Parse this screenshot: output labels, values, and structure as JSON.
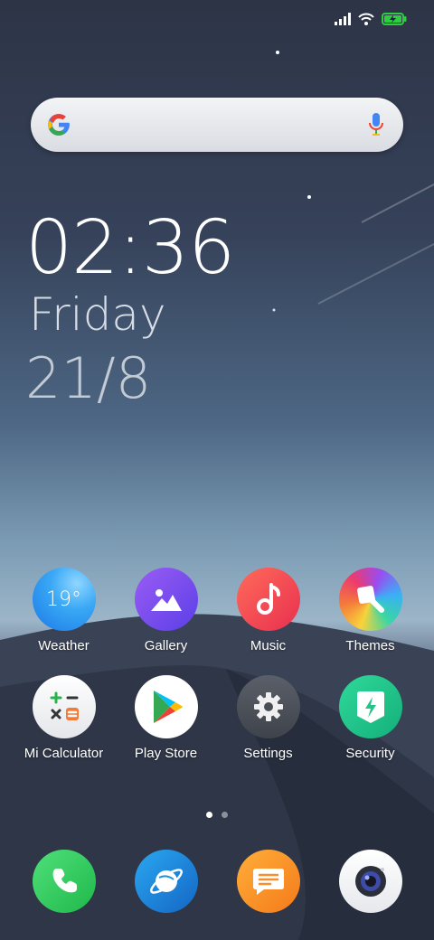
{
  "status_bar": {
    "signal_icon": "cellular-signal-icon",
    "wifi_icon": "wifi-icon",
    "battery_icon": "battery-charging-icon",
    "battery_color": "#2ecc40"
  },
  "search": {
    "logo_icon": "google-g-icon",
    "mic_icon": "microphone-icon"
  },
  "clock": {
    "time": "02:36",
    "day": "Friday",
    "date": "21/8"
  },
  "apps": [
    {
      "label": "Weather",
      "icon": "weather-icon",
      "temp": "19°",
      "color": "#2b9af3"
    },
    {
      "label": "Gallery",
      "icon": "gallery-icon",
      "color": "#7a4cf0"
    },
    {
      "label": "Music",
      "icon": "music-note-icon",
      "color": "#f0455a"
    },
    {
      "label": "Themes",
      "icon": "themes-brush-icon",
      "color": "#f6a13a"
    },
    {
      "label": "Mi Calculator",
      "icon": "calculator-icon",
      "color": "#f4f4f4"
    },
    {
      "label": "Play Store",
      "icon": "play-store-icon",
      "color": "#ffffff"
    },
    {
      "label": "Settings",
      "icon": "gear-icon",
      "color": "#4a4e57"
    },
    {
      "label": "Security",
      "icon": "security-shield-icon",
      "color": "#22c48a"
    }
  ],
  "dock": [
    {
      "name": "phone",
      "icon": "phone-icon",
      "color": "#2ecc5a"
    },
    {
      "name": "browser",
      "icon": "browser-planet-icon",
      "color": "#1f8fe0"
    },
    {
      "name": "messages",
      "icon": "messages-icon",
      "color": "#f7902a"
    },
    {
      "name": "camera",
      "icon": "camera-icon",
      "color": "#ffffff"
    }
  ],
  "page_indicator": {
    "pages": 2,
    "current": 1
  }
}
